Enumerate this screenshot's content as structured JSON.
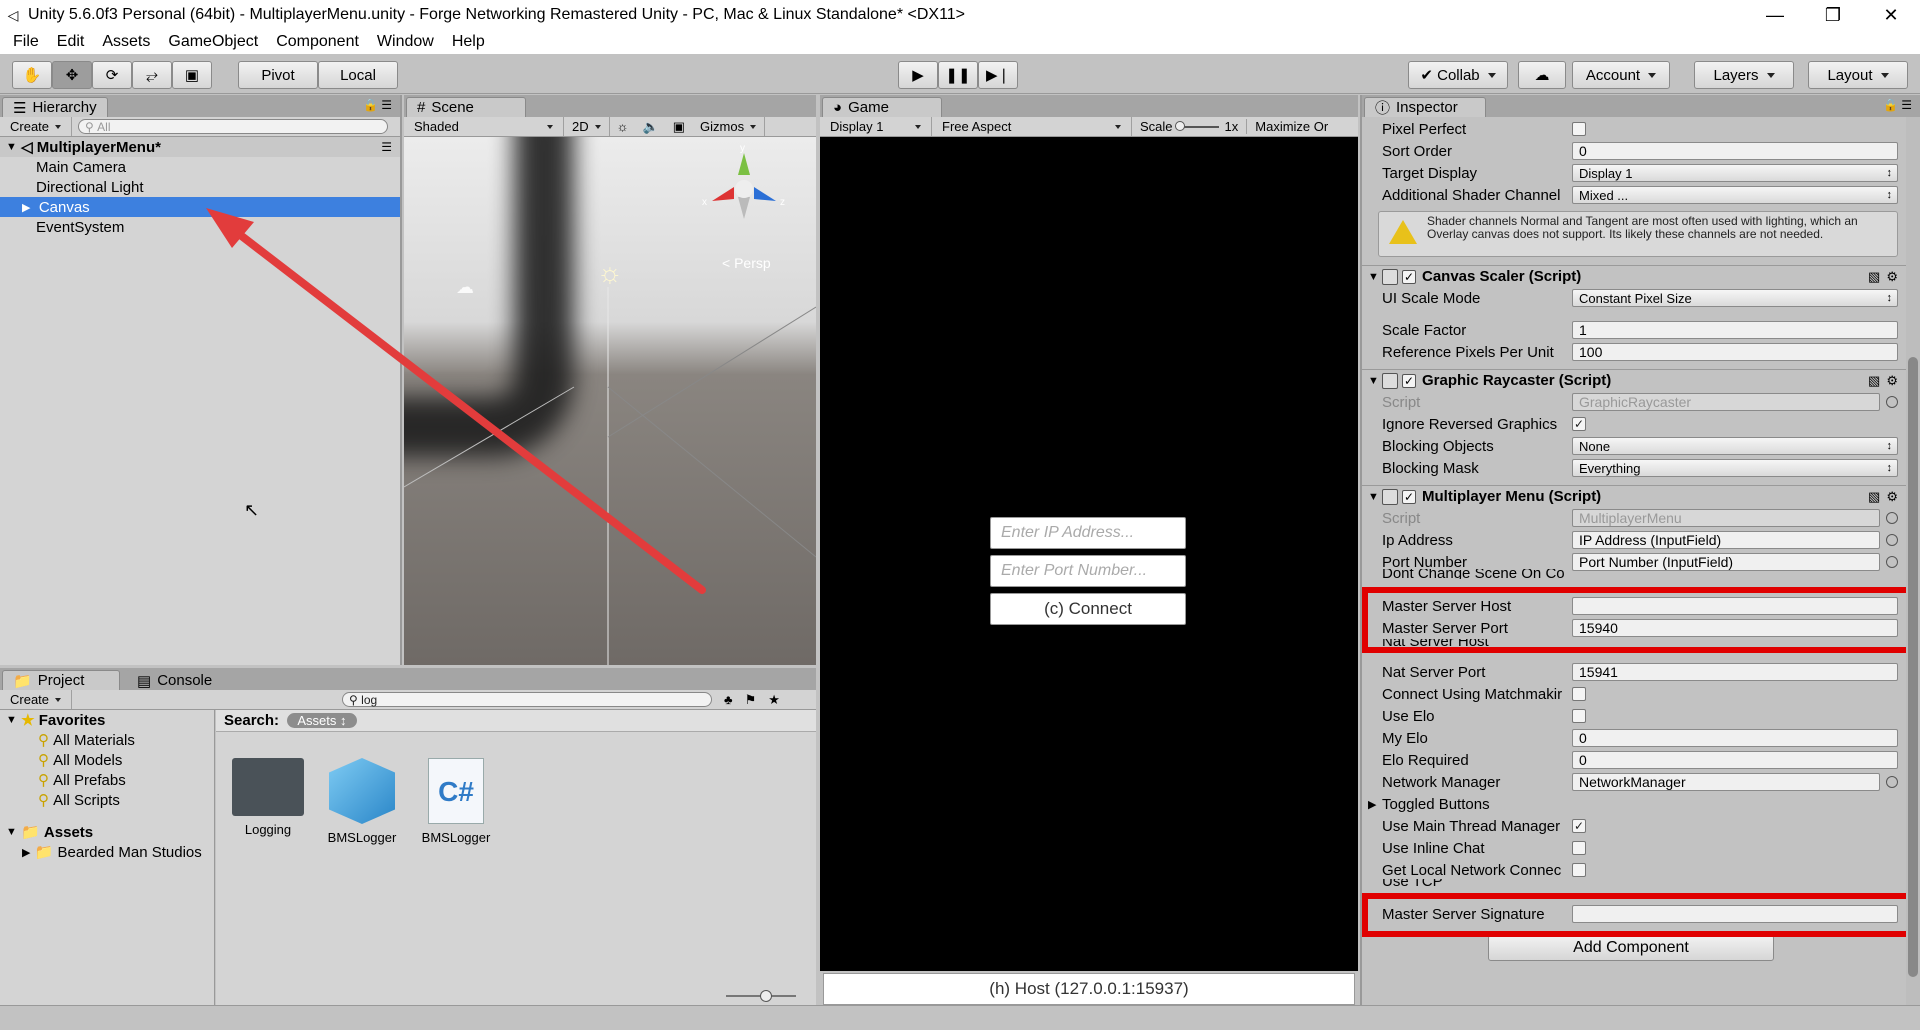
{
  "window": {
    "title": "Unity 5.6.0f3 Personal (64bit) - MultiplayerMenu.unity - Forge Networking Remastered Unity - PC, Mac & Linux Standalone* <DX11>",
    "minimize": "—",
    "maximize": "❐",
    "close": "✕"
  },
  "menu": [
    "File",
    "Edit",
    "Assets",
    "GameObject",
    "Component",
    "Window",
    "Help"
  ],
  "toolbar": {
    "pivot": "Pivot",
    "local": "Local",
    "collab": "Collab",
    "account": "Account",
    "layers": "Layers",
    "layout": "Layout"
  },
  "hierarchy": {
    "tab": "Hierarchy",
    "create": "Create",
    "search_placeholder": "All",
    "scene": "MultiplayerMenu*",
    "items": [
      "Main Camera",
      "Directional Light",
      "Canvas",
      "EventSystem"
    ]
  },
  "scene": {
    "tab": "Scene",
    "shading": "Shaded",
    "mode2d": "2D",
    "gizmos": "Gizmos",
    "persp": "Persp",
    "axis_x": "x",
    "axis_y": "y",
    "axis_z": "z"
  },
  "game": {
    "tab": "Game",
    "display": "Display 1",
    "aspect": "Free Aspect",
    "scale_label": "Scale",
    "scale_value": "1x",
    "maximize": "Maximize Or",
    "ip_placeholder": "Enter IP Address...",
    "port_placeholder": "Enter Port Number...",
    "connect": "(c) Connect",
    "host": "(h) Host (127.0.0.1:15937)"
  },
  "inspector": {
    "tab": "Inspector",
    "canvas_rows": [
      {
        "label": "Pixel Perfect",
        "type": "check",
        "value": ""
      },
      {
        "label": "Sort Order",
        "type": "text",
        "value": "0"
      },
      {
        "label": "Target Display",
        "type": "dd",
        "value": "Display 1"
      },
      {
        "label": "Additional Shader Channel",
        "type": "dd",
        "value": "Mixed ..."
      }
    ],
    "warning": "Shader channels Normal and Tangent are most often used with lighting, which an Overlay canvas does not support. Its likely these channels are not needed.",
    "canvas_scaler": {
      "title": "Canvas Scaler (Script)",
      "ui_scale_label": "UI Scale Mode",
      "ui_scale_value": "Constant Pixel Size",
      "scale_factor_label": "Scale Factor",
      "scale_factor_value": "1",
      "ref_ppu_label": "Reference Pixels Per Unit",
      "ref_ppu_value": "100"
    },
    "raycaster": {
      "title": "Graphic Raycaster (Script)",
      "script_label": "Script",
      "script_value": "GraphicRaycaster",
      "ignore_label": "Ignore Reversed Graphics",
      "ignore_value": "✓",
      "blocking_objects_label": "Blocking Objects",
      "blocking_objects_value": "None",
      "blocking_mask_label": "Blocking Mask",
      "blocking_mask_value": "Everything"
    },
    "mp_menu": {
      "title": "Multiplayer Menu (Script)",
      "script_label": "Script",
      "script_value": "MultiplayerMenu",
      "ip_label": "Ip Address",
      "ip_value": "IP Address (InputField)",
      "port_label": "Port Number",
      "port_value": "Port Number (InputField)",
      "dont_change_label": "Dont Change Scene On Co",
      "msh_label": "Master Server Host",
      "msh_value": "",
      "msp_label": "Master Server Port",
      "msp_value": "15940",
      "nat_host_label": "Nat Server Host",
      "nat_port_label": "Nat Server Port",
      "nat_port_value": "15941",
      "matchmaking_label": "Connect Using Matchmakir",
      "use_elo_label": "Use Elo",
      "my_elo_label": "My Elo",
      "my_elo_value": "0",
      "elo_req_label": "Elo Required",
      "elo_req_value": "0",
      "nm_label": "Network Manager",
      "nm_value": "NetworkManager",
      "toggled_label": "Toggled Buttons",
      "main_thread_label": "Use Main Thread Manager",
      "main_thread_value": "✓",
      "inline_chat_label": "Use Inline Chat",
      "local_net_label": "Get Local Network Connec",
      "use_tcp_label": "Use TCP",
      "mss_label": "Master Server Signature",
      "mss_value": ""
    },
    "add_component": "Add Component"
  },
  "project": {
    "tab": "Project",
    "console_tab": "Console",
    "create": "Create",
    "search_value": "log",
    "favorites": "Favorites",
    "fav_items": [
      "All Materials",
      "All Models",
      "All Prefabs",
      "All Scripts"
    ],
    "assets": "Assets",
    "asset_children": [
      "Bearded Man Studios"
    ],
    "search_label": "Search:",
    "search_scope": "Assets",
    "results": [
      {
        "name": "Logging",
        "kind": "folder"
      },
      {
        "name": "BMSLogger",
        "kind": "prefab"
      },
      {
        "name": "BMSLogger",
        "kind": "script",
        "glyph": "C#"
      }
    ]
  },
  "colors": {
    "selection": "#3d80df",
    "highlight_box": "#e00000",
    "arrow": "#e23c3c"
  }
}
